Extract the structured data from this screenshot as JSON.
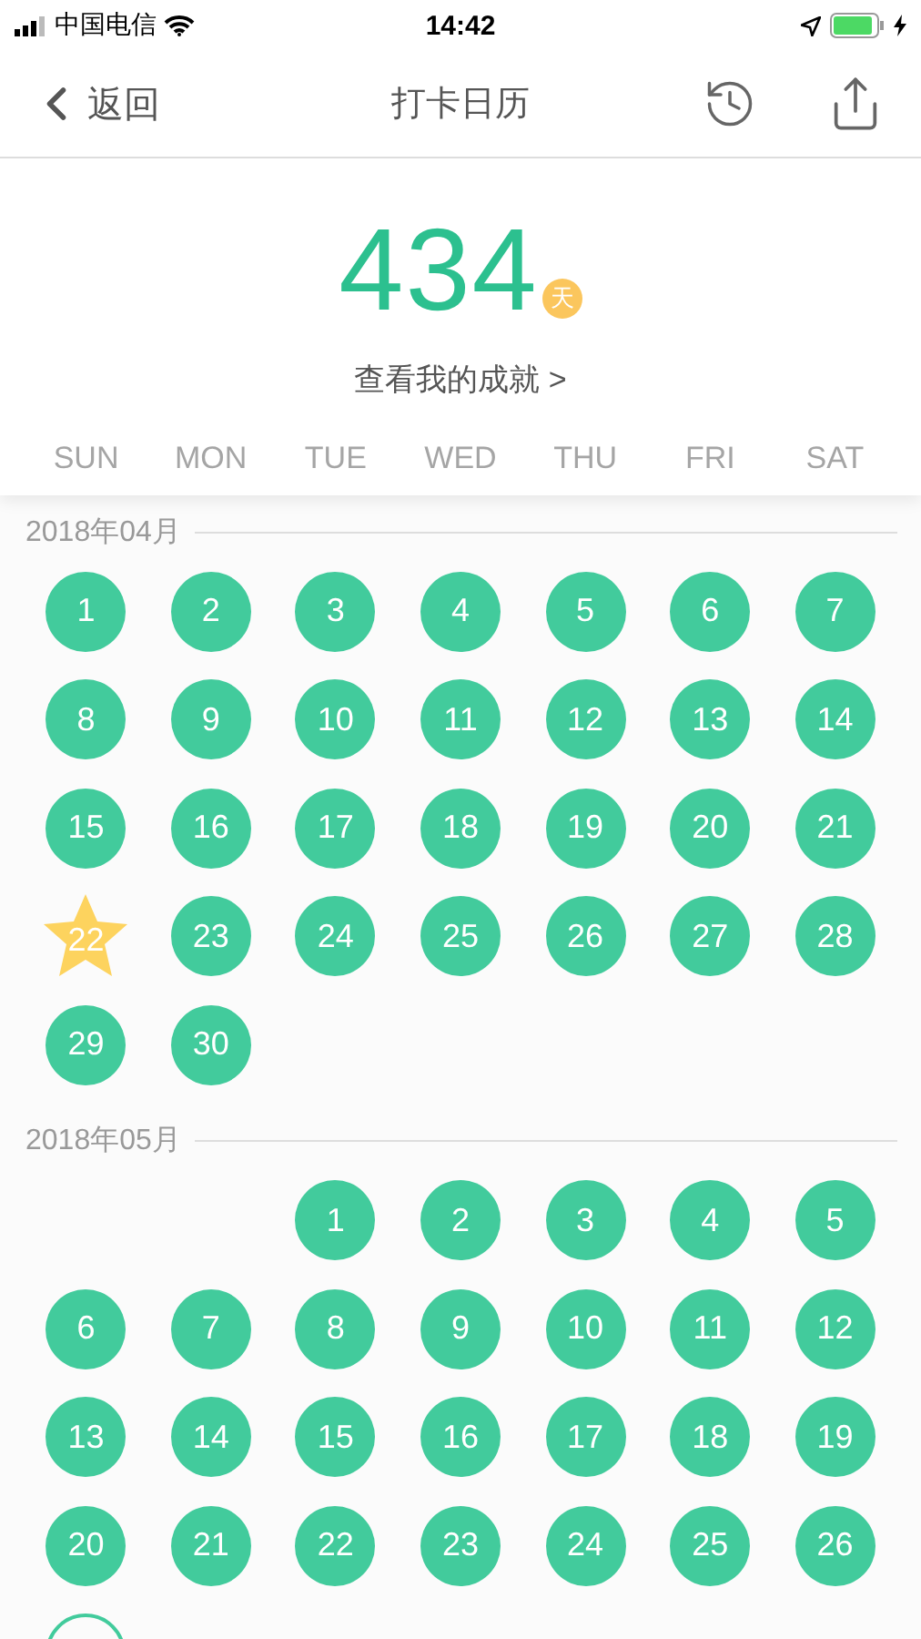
{
  "status_bar": {
    "carrier": "中国电信",
    "time": "14:42"
  },
  "nav": {
    "back": "返回",
    "title": "打卡日历"
  },
  "summary": {
    "count": "434",
    "unit": "天",
    "link": "查看我的成就 >"
  },
  "weekdays": [
    "SUN",
    "MON",
    "TUE",
    "WED",
    "THU",
    "FRI",
    "SAT"
  ],
  "months": [
    {
      "title": "2018年04月",
      "days": [
        {
          "kind": "done",
          "label": "1"
        },
        {
          "kind": "done",
          "label": "2"
        },
        {
          "kind": "done",
          "label": "3"
        },
        {
          "kind": "done",
          "label": "4"
        },
        {
          "kind": "done",
          "label": "5"
        },
        {
          "kind": "done",
          "label": "6"
        },
        {
          "kind": "done",
          "label": "7"
        },
        {
          "kind": "done",
          "label": "8"
        },
        {
          "kind": "done",
          "label": "9"
        },
        {
          "kind": "done",
          "label": "10"
        },
        {
          "kind": "done",
          "label": "11"
        },
        {
          "kind": "done",
          "label": "12"
        },
        {
          "kind": "done",
          "label": "13"
        },
        {
          "kind": "done",
          "label": "14"
        },
        {
          "kind": "done",
          "label": "15"
        },
        {
          "kind": "done",
          "label": "16"
        },
        {
          "kind": "done",
          "label": "17"
        },
        {
          "kind": "done",
          "label": "18"
        },
        {
          "kind": "done",
          "label": "19"
        },
        {
          "kind": "done",
          "label": "20"
        },
        {
          "kind": "done",
          "label": "21"
        },
        {
          "kind": "star",
          "label": "22"
        },
        {
          "kind": "done",
          "label": "23"
        },
        {
          "kind": "done",
          "label": "24"
        },
        {
          "kind": "done",
          "label": "25"
        },
        {
          "kind": "done",
          "label": "26"
        },
        {
          "kind": "done",
          "label": "27"
        },
        {
          "kind": "done",
          "label": "28"
        },
        {
          "kind": "done",
          "label": "29"
        },
        {
          "kind": "done",
          "label": "30"
        }
      ]
    },
    {
      "title": "2018年05月",
      "days": [
        {
          "kind": "blank"
        },
        {
          "kind": "blank"
        },
        {
          "kind": "done",
          "label": "1"
        },
        {
          "kind": "done",
          "label": "2"
        },
        {
          "kind": "done",
          "label": "3"
        },
        {
          "kind": "done",
          "label": "4"
        },
        {
          "kind": "done",
          "label": "5"
        },
        {
          "kind": "done",
          "label": "6"
        },
        {
          "kind": "done",
          "label": "7"
        },
        {
          "kind": "done",
          "label": "8"
        },
        {
          "kind": "done",
          "label": "9"
        },
        {
          "kind": "done",
          "label": "10"
        },
        {
          "kind": "done",
          "label": "11"
        },
        {
          "kind": "done",
          "label": "12"
        },
        {
          "kind": "done",
          "label": "13"
        },
        {
          "kind": "done",
          "label": "14"
        },
        {
          "kind": "done",
          "label": "15"
        },
        {
          "kind": "done",
          "label": "16"
        },
        {
          "kind": "done",
          "label": "17"
        },
        {
          "kind": "done",
          "label": "18"
        },
        {
          "kind": "done",
          "label": "19"
        },
        {
          "kind": "done",
          "label": "20"
        },
        {
          "kind": "done",
          "label": "21"
        },
        {
          "kind": "done",
          "label": "22"
        },
        {
          "kind": "done",
          "label": "23"
        },
        {
          "kind": "done",
          "label": "24"
        },
        {
          "kind": "done",
          "label": "25"
        },
        {
          "kind": "done",
          "label": "26"
        },
        {
          "kind": "open"
        }
      ]
    }
  ]
}
